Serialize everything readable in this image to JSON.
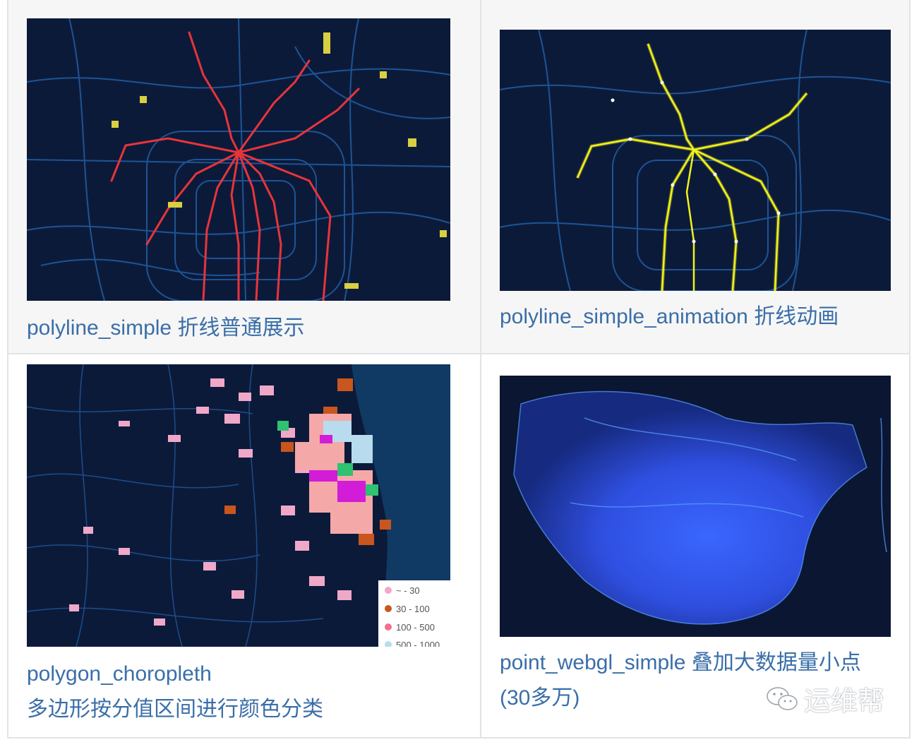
{
  "tiles": [
    {
      "caption": "polyline_simple 折线普通展示",
      "map_style": "red-polylines"
    },
    {
      "caption": "polyline_simple_animation 折线动画",
      "map_style": "yellow-animated-polylines"
    },
    {
      "caption_line1": "polygon_choropleth",
      "caption_line2": "多边形按分值区间进行颜色分类",
      "map_style": "choropleth",
      "legend": [
        "~ - 30",
        "30 - 100",
        "100 - 500",
        "500 - 1000"
      ],
      "legend_colors": [
        "#f0a8c8",
        "#c8561e",
        "#f36f8a",
        "#b8dcee"
      ]
    },
    {
      "caption_line1": "point_webgl_simple 叠加大数据量小点",
      "caption_line2": "(30多万)",
      "map_style": "webgl-points"
    }
  ],
  "watermark": {
    "text": "运维帮",
    "icon": "wechat-icon"
  },
  "colors": {
    "link": "#3a6ea8",
    "map_bg": "#0c1a3a",
    "road": "#1e5a9c",
    "red_line": "#e8343a",
    "yellow_line": "#f3f21a"
  }
}
